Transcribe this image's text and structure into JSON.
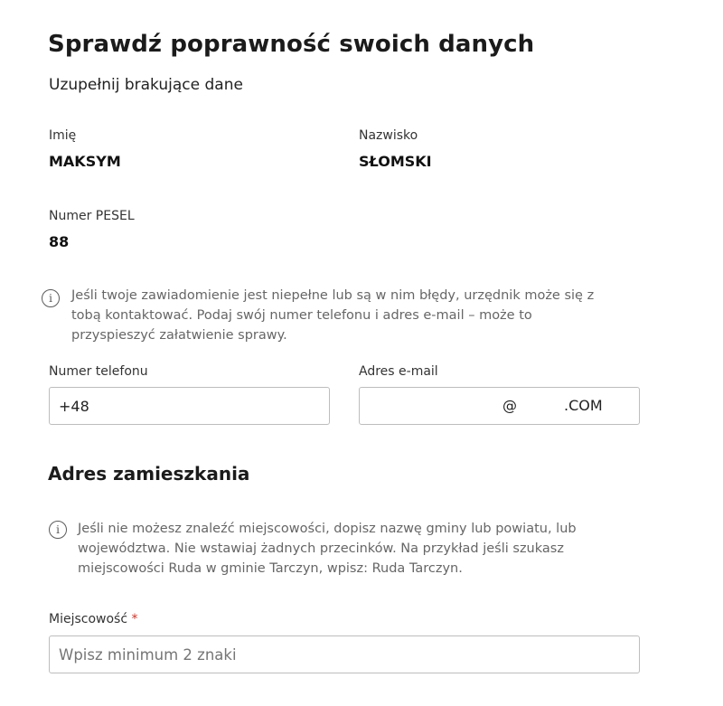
{
  "header": {
    "title": "Sprawdź poprawność swoich danych",
    "subtitle": "Uzupełnij brakujące dane"
  },
  "person": {
    "first_name_label": "Imię",
    "first_name_value": "MAKSYM",
    "last_name_label": "Nazwisko",
    "last_name_value": "SŁOMSKI",
    "pesel_label": "Numer PESEL",
    "pesel_value": "88"
  },
  "contact_info": {
    "icon": "info-icon",
    "text": "Jeśli twoje zawiadomienie jest niepełne lub są w nim błędy, urzędnik może się z tobą kontaktować. Podaj swój numer telefonu i adres e-mail – może to przyspieszyć załatwienie sprawy."
  },
  "phone": {
    "label": "Numer telefonu",
    "value": "+48"
  },
  "email": {
    "label": "Adres e-mail",
    "value_at": "@",
    "value_domain": ".COM"
  },
  "address": {
    "section_title": "Adres zamieszkania",
    "info_icon": "info-icon",
    "info_text": "Jeśli nie możesz znaleźć miejscowości, dopisz nazwę gminy lub powiatu, lub województwa. Nie wstawiaj żadnych przecinków. Na przykład jeśli szukasz miejscowości Ruda w gminie Tarczyn, wpisz: Ruda Tarczyn.",
    "city_label": "Miejscowość",
    "city_required_mark": "*",
    "city_placeholder": "Wpisz minimum 2 znaki"
  }
}
